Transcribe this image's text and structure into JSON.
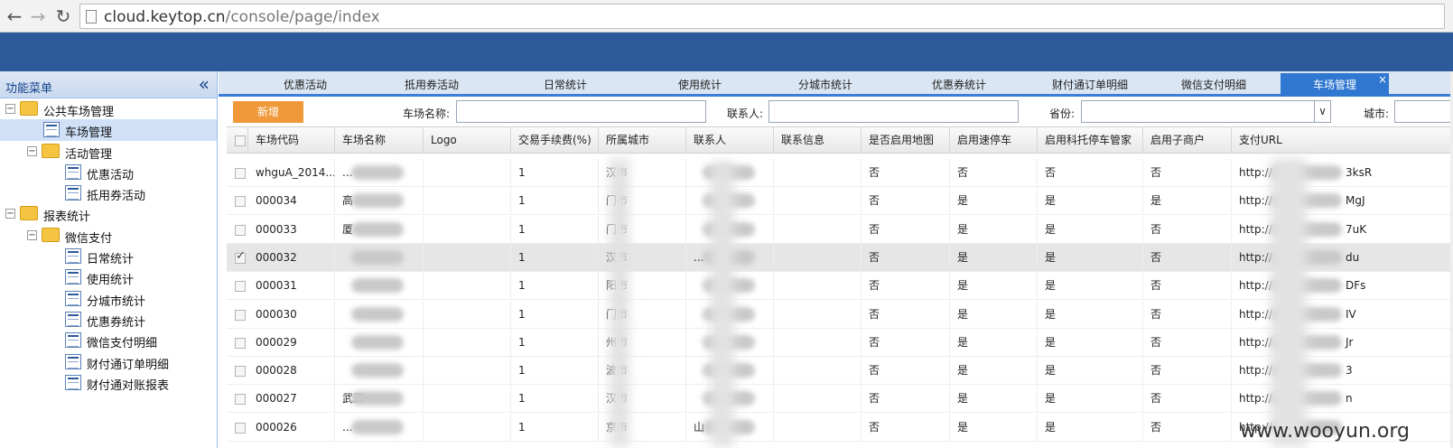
{
  "browser": {
    "url_host": "cloud.keytop.cn",
    "url_path": "/console/page/index"
  },
  "sidebar": {
    "title": "功能菜单",
    "items": [
      {
        "label": "公共车场管理",
        "level": 0,
        "type": "folder",
        "expander": "−"
      },
      {
        "label": "车场管理",
        "level": 1,
        "type": "page",
        "selected": true
      },
      {
        "label": "活动管理",
        "level": 1,
        "type": "folder",
        "expander": "−"
      },
      {
        "label": "优惠活动",
        "level": 2,
        "type": "page"
      },
      {
        "label": "抵用券活动",
        "level": 2,
        "type": "page"
      },
      {
        "label": "报表统计",
        "level": 0,
        "type": "folder",
        "expander": "−"
      },
      {
        "label": "微信支付",
        "level": 1,
        "type": "folder",
        "expander": "−"
      },
      {
        "label": "日常统计",
        "level": 2,
        "type": "page"
      },
      {
        "label": "使用统计",
        "level": 2,
        "type": "page"
      },
      {
        "label": "分城市统计",
        "level": 2,
        "type": "page"
      },
      {
        "label": "优惠券统计",
        "level": 2,
        "type": "page"
      },
      {
        "label": "微信支付明细",
        "level": 2,
        "type": "page"
      },
      {
        "label": "财付通订单明细",
        "level": 2,
        "type": "page"
      },
      {
        "label": "财付通对账报表",
        "level": 2,
        "type": "page"
      }
    ]
  },
  "tabs": [
    {
      "label": "优惠活动"
    },
    {
      "label": "抵用券活动"
    },
    {
      "label": "日常统计"
    },
    {
      "label": "使用统计"
    },
    {
      "label": "分城市统计"
    },
    {
      "label": "优惠券统计"
    },
    {
      "label": "财付通订单明细"
    },
    {
      "label": "微信支付明细"
    },
    {
      "label": "车场管理",
      "active": true
    }
  ],
  "toolbar": {
    "add_label": "新增",
    "name_label": "车场名称:",
    "contact_label": "联系人:",
    "province_label": "省份:",
    "city_label": "城市:"
  },
  "grid": {
    "columns": [
      "车场代码",
      "车场名称",
      "Logo",
      "交易手续费(%)",
      "所属城市",
      "联系人",
      "联系信息",
      "是否启用地图",
      "启用速停车",
      "启用科托停车管家",
      "启用子商户",
      "支付URL"
    ],
    "rows": [
      {
        "code": "whguA_2014...",
        "name": "...",
        "fee": "1",
        "city": "汉市",
        "contact": "",
        "map": "否",
        "quick": "否",
        "keytop": "否",
        "sub": "否",
        "url": "http://",
        "url_tail": "3ksR",
        "checked": false
      },
      {
        "code": "000034",
        "name": "高",
        "fee": "1",
        "city": "门市",
        "contact": "",
        "map": "否",
        "quick": "是",
        "keytop": "是",
        "sub": "是",
        "url": "http://",
        "url_tail": "MgJ",
        "checked": false
      },
      {
        "code": "000033",
        "name": "厦",
        "fee": "1",
        "city": "门市",
        "contact": "",
        "map": "否",
        "quick": "是",
        "keytop": "是",
        "sub": "否",
        "url": "http://",
        "url_tail": "7uK",
        "checked": false
      },
      {
        "code": "000032",
        "name": "",
        "fee": "1",
        "city": "汉市",
        "contact": "...",
        "map": "否",
        "quick": "是",
        "keytop": "是",
        "sub": "否",
        "url": "http://",
        "url_tail": "du",
        "checked": true
      },
      {
        "code": "000031",
        "name": "",
        "fee": "1",
        "city": "阳市",
        "contact": "",
        "map": "否",
        "quick": "是",
        "keytop": "是",
        "sub": "否",
        "url": "http://",
        "url_tail": "DFs",
        "checked": false
      },
      {
        "code": "000030",
        "name": "",
        "fee": "1",
        "city": "门市",
        "contact": "",
        "map": "否",
        "quick": "是",
        "keytop": "是",
        "sub": "否",
        "url": "http://",
        "url_tail": "IV",
        "checked": false
      },
      {
        "code": "000029",
        "name": "",
        "fee": "1",
        "city": "州市",
        "contact": "",
        "map": "否",
        "quick": "是",
        "keytop": "是",
        "sub": "否",
        "url": "http://",
        "url_tail": "Jr",
        "checked": false
      },
      {
        "code": "000028",
        "name": "",
        "fee": "1",
        "city": "波市",
        "contact": "",
        "map": "否",
        "quick": "是",
        "keytop": "是",
        "sub": "否",
        "url": "http://",
        "url_tail": "3",
        "checked": false
      },
      {
        "code": "000027",
        "name": "武汉",
        "fee": "1",
        "city": "汉市",
        "contact": "",
        "map": "否",
        "quick": "是",
        "keytop": "是",
        "sub": "否",
        "url": "http://",
        "url_tail": "n",
        "checked": false
      },
      {
        "code": "000026",
        "name": "...",
        "fee": "1",
        "city": "京市",
        "contact": "山",
        "map": "否",
        "quick": "是",
        "keytop": "是",
        "sub": "否",
        "url": "http://",
        "url_tail": "",
        "checked": false
      }
    ]
  },
  "watermark": "www.wooyun.org",
  "colors": {
    "header": "#2d5a9a",
    "active_tab": "#2f77d1",
    "add_button": "#f0993a"
  }
}
